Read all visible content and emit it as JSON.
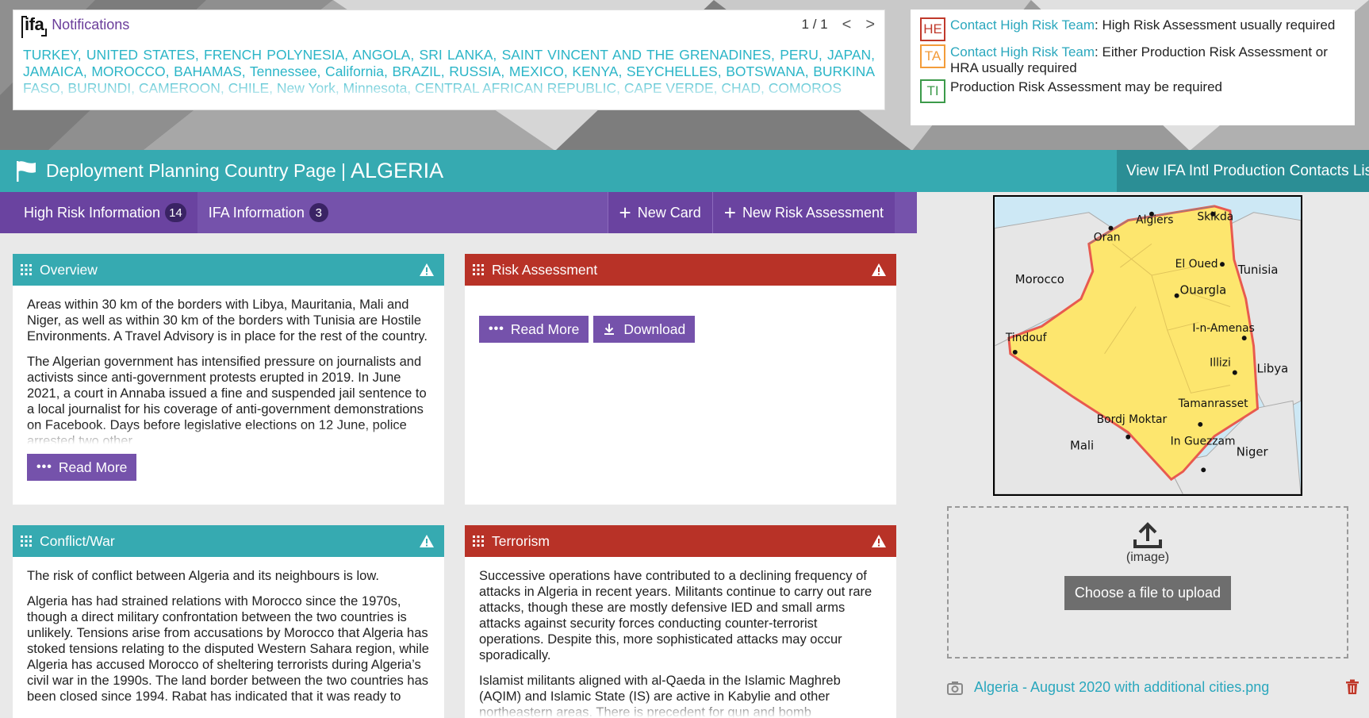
{
  "notifications": {
    "logo": "ifa",
    "title": "Notifications",
    "pager": "1 / 1",
    "prev": "<",
    "next": ">",
    "text": "TURKEY, UNITED STATES, FRENCH POLYNESIA, ANGOLA, SRI LANKA, SAINT VINCENT AND THE GRENADINES, PERU, JAPAN, JAMAICA, MOROCCO, BAHAMAS, Tennessee, California, BRAZIL, RUSSIA, MEXICO, KENYA, SEYCHELLES, BOTSWANA, BURKINA FASO, BURUNDI, CAMEROON, CHILE, New York, Minnesota, CENTRAL AFRICAN REPUBLIC, CAPE VERDE, CHAD, COMOROS"
  },
  "legend": [
    {
      "code": "HE",
      "link": "Contact High Risk Team",
      "text": ": High Risk Assessment usually required",
      "color": "#c0392b"
    },
    {
      "code": "TA",
      "link": "Contact High Risk Team",
      "text": ": Either Production Risk Assessment or HRA usually required",
      "color": "#f39c3a"
    },
    {
      "code": "TI",
      "link": "",
      "text": "Production Risk Assessment may be required",
      "color": "#3c9a4a"
    }
  ],
  "header": {
    "title": "Deployment Planning Country Page |",
    "country": "ALGERIA",
    "contacts_button": "View IFA Intl Production Contacts List"
  },
  "tabs": [
    {
      "label": "High Risk Information",
      "count": "14"
    },
    {
      "label": "IFA Information",
      "count": "3"
    }
  ],
  "actions": {
    "new_card": "New Card",
    "new_risk": "New Risk Assessment"
  },
  "cards": {
    "overview": {
      "title": "Overview",
      "p1": "Areas within 30 km of the borders with Libya, Mauritania, Mali and Niger, as well as within 30 km of the borders with Tunisia are Hostile Environments. A Travel Advisory is in place for the rest of the country.",
      "p2": "The Algerian government has intensified pressure on journalists and activists since anti-government protests erupted in 2019. In June 2021, a court in Annaba issued a fine and suspended jail sentence to a local journalist for his coverage of anti-government demonstrations on Facebook. Days before legislative elections on 12 June, police arrested two other",
      "read_more": "Read More"
    },
    "risk": {
      "title": "Risk Assessment",
      "read_more": "Read More",
      "download": "Download"
    },
    "conflict": {
      "title": "Conflict/War",
      "p1": "The risk of conflict between Algeria and its neighbours is low.",
      "p2": "Algeria has had strained relations with Morocco since the 1970s, though a direct military confrontation between the two countries is unlikely. Tensions arise from accusations by Morocco that Algeria has stoked tensions relating to the disputed Western Sahara region, while Algeria has accused Morocco of sheltering terrorists during Algeria’s civil war in the 1990s. The land border between the two countries has been closed since 1994. Rabat has indicated that it was ready to"
    },
    "terrorism": {
      "title": "Terrorism",
      "p1": "Successive operations have contributed to a declining frequency of attacks in Algeria in recent years. Militants continue to carry out rare attacks, though these are mostly defensive IED and small arms attacks against security forces conducting counter-terrorist operations. Despite this, more sophisticated attacks may occur sporadically.",
      "p2": "Islamist militants aligned with al-Qaeda in the Islamic Maghreb (AQIM) and Islamic State (IS) are active in Kabylie and other northeastern areas. There is precedent for gun and bomb"
    }
  },
  "map": {
    "labels": {
      "algiers": "Algiers",
      "skikda": "Skikda",
      "oran": "Oran",
      "el_oued": "El Oued",
      "tunisia": "Tunisia",
      "morocco": "Morocco",
      "ouargla": "Ouargla",
      "in_amenas": "I-n-Amenas",
      "tindouf": "Tindouf",
      "illizi": "Illizi",
      "libya": "Libya",
      "tamanrasset": "Tamanrasset",
      "bordj": "Bordj Moktar",
      "in_guezzam": "In Guezzam",
      "mali": "Mali",
      "niger": "Niger"
    }
  },
  "upload": {
    "hint": "(image)",
    "button": "Choose a file to upload",
    "file_name": "Algeria - August 2020 with additional cities.png"
  },
  "colors": {
    "teal": "#36aab1",
    "purple": "#7552ab",
    "red": "#b83227",
    "link": "#2aa7bd"
  }
}
